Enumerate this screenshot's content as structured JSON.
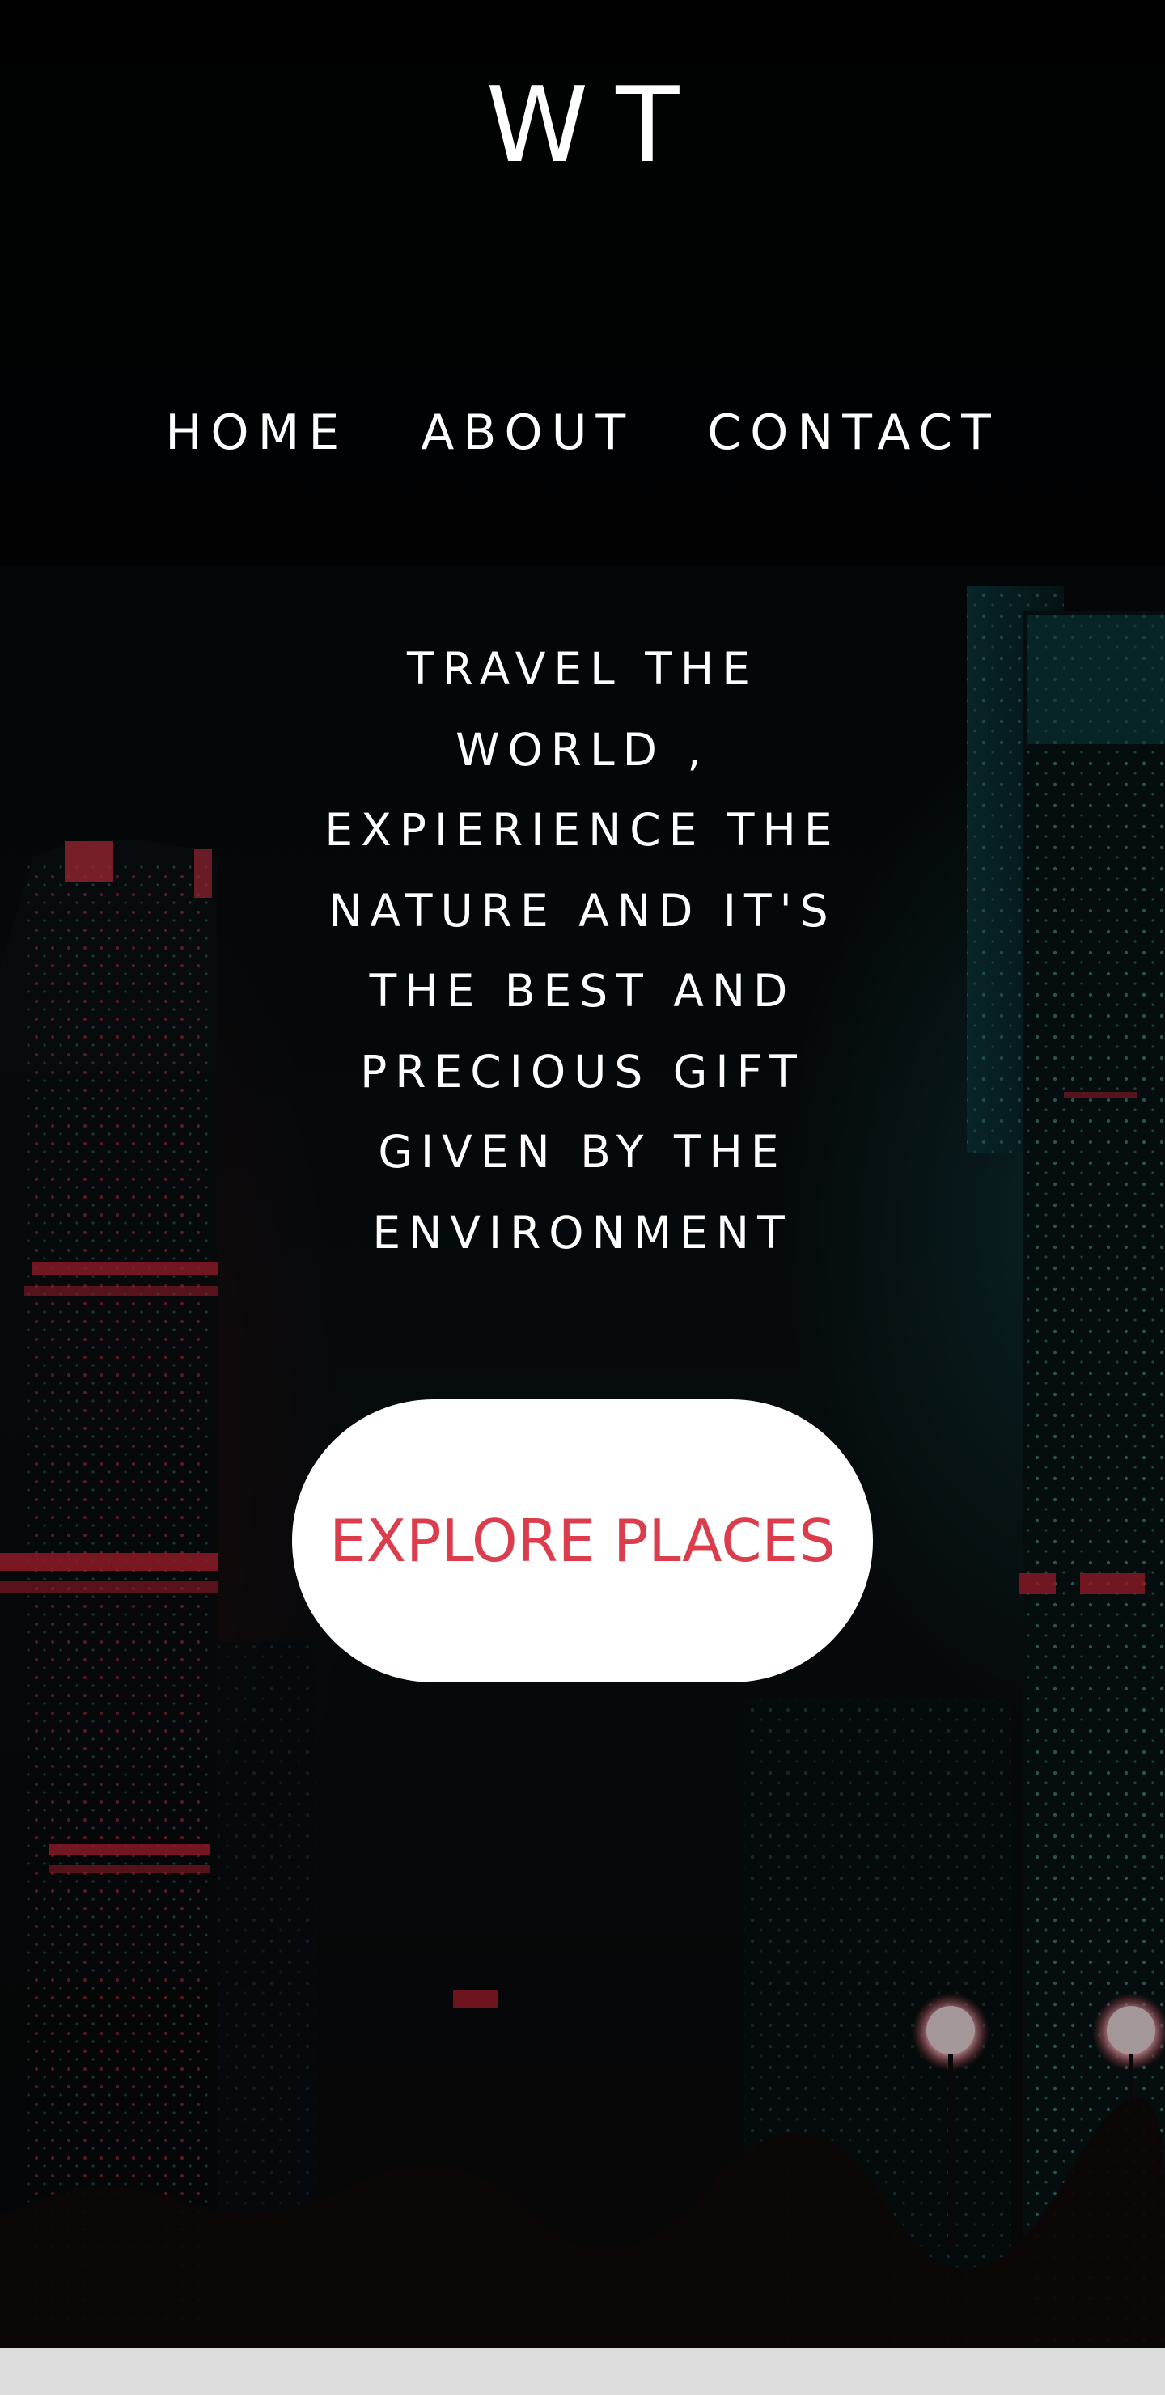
{
  "brand": {
    "logo": "WT"
  },
  "nav": {
    "items": [
      "HOME",
      "ABOUT",
      "CONTACT"
    ]
  },
  "hero": {
    "tagline": "TRAVEL THE WORLD , EXPIERIENCE THE NATURE AND IT'S THE BEST AND PRECIOUS GIFT GIVEN BY THE ENVIRONMENT",
    "cta_label": "EXPLORE PLACES"
  },
  "colors": {
    "accent": "#dc3d4d",
    "text": "#ffffff",
    "background": "#050607",
    "footer_strip": "#dcdcdc"
  },
  "background": {
    "description_icon": "night-city-skyline-image"
  }
}
